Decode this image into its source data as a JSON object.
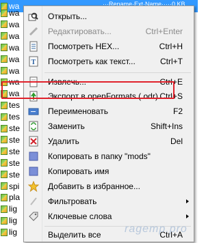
{
  "file_list": {
    "top_row_fragment": "···Rename·Ext·Name·····0.KB",
    "rows": [
      "wa",
      "wa",
      "wa",
      "wa",
      "wa",
      "wa",
      "wa",
      "wa",
      "wa",
      "tes",
      "tes",
      "ste",
      "ste",
      "ste",
      "ste",
      "ste",
      "spi",
      "pla",
      "lig",
      "lig",
      "lig"
    ]
  },
  "menu": {
    "items": [
      {
        "icon": "folder-open-icon",
        "label": "Открыть...",
        "shortcut": "",
        "disabled": false
      },
      {
        "icon": "pencil-icon",
        "label": "Редактировать...",
        "shortcut": "Ctrl+Enter",
        "disabled": true
      },
      {
        "icon": "hex-document-icon",
        "label": "Посмотреть HEX...",
        "shortcut": "Ctrl+H",
        "disabled": false
      },
      {
        "icon": "text-document-icon",
        "label": "Посмотреть как текст...",
        "shortcut": "Ctrl+T",
        "disabled": false
      },
      {
        "icon": "extract-icon",
        "label": "Извлечь...",
        "shortcut": "Ctrl+E",
        "disabled": false
      },
      {
        "icon": "export-icon",
        "label": "Экспорт в openFormats (.odr)",
        "shortcut": "Ctrl+S",
        "disabled": false
      },
      {
        "icon": "rename-icon",
        "label": "Переименовать",
        "shortcut": "F2",
        "disabled": false
      },
      {
        "icon": "replace-icon",
        "label": "Заменить",
        "shortcut": "Shift+Ins",
        "disabled": false
      },
      {
        "icon": "delete-icon",
        "label": "Удалить",
        "shortcut": "Del",
        "disabled": false
      },
      {
        "icon": "copy-to-folder-icon",
        "label": "Копировать в папку \"mods\"",
        "shortcut": "",
        "disabled": false
      },
      {
        "icon": "copy-name-icon",
        "label": "Копировать имя",
        "shortcut": "",
        "disabled": false
      },
      {
        "icon": "star-icon",
        "label": "Добавить в избранное...",
        "shortcut": "",
        "disabled": false
      },
      {
        "icon": "filter-icon",
        "label": "Фильтровать",
        "shortcut": "",
        "disabled": false,
        "submenu": true
      },
      {
        "icon": "tag-icon",
        "label": "Ключевые слова",
        "shortcut": "",
        "disabled": false,
        "submenu": true
      },
      {
        "icon": "",
        "label": "Выделить все",
        "shortcut": "Ctrl+A",
        "disabled": false
      }
    ]
  },
  "watermark": "ragemp.pro",
  "colors": {
    "highlight_border": "#e0202a",
    "selection": "#3399ff"
  }
}
